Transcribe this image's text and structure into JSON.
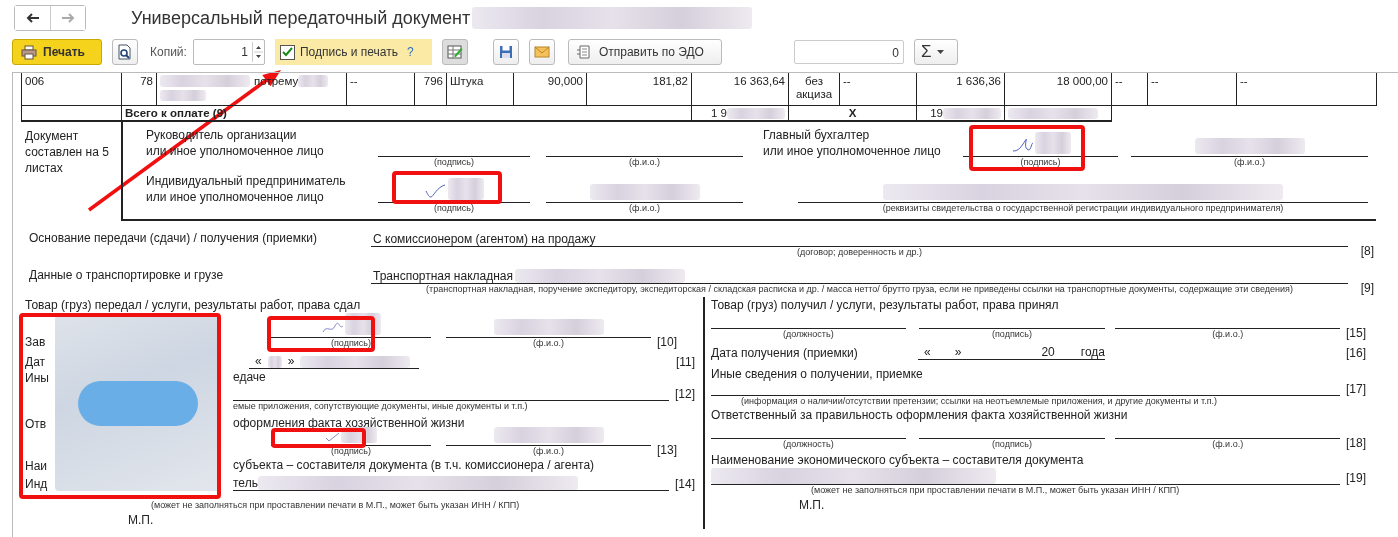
{
  "window": {
    "title": "Универсальный передаточный документ"
  },
  "toolbar": {
    "print": "Печать",
    "copies_label": "Копий:",
    "copies": "1",
    "sign_and_print": {
      "label": "Подпись и печать",
      "checked": true,
      "help": "?"
    },
    "send_edo": "Отправить по ЭДО",
    "total_field": "0",
    "sum_button": "Σ"
  },
  "table": {
    "rows": [
      {
        "cells": [
          "006",
          "78",
          "потрему",
          "--",
          "796",
          "Штука",
          "90,000",
          "181,82",
          "16 363,64",
          "без акциза",
          "--",
          "1 636,36",
          "18 000,00",
          "--",
          "--",
          "--"
        ]
      }
    ],
    "total": {
      "label": "Всего к оплате (9)",
      "amount": "1 9",
      "excise": "X",
      "total_with_tax": "19"
    }
  },
  "signatures": {
    "note": "Документ составлен на 5 листах",
    "head": {
      "label_lines": [
        "Руководитель организации",
        "или иное уполномоченное лицо"
      ],
      "sign_caption": "(подпись)",
      "name_caption": "(ф.и.о.)",
      "signed": false
    },
    "chief_accountant": {
      "label_lines": [
        "Главный бухгалтер",
        "или иное уполномоченное лицо"
      ],
      "sign_caption": "(подпись)",
      "name_caption": "(ф.и.о.)",
      "signed": true
    },
    "entrepreneur": {
      "label_lines": [
        "Индивидуальный предприниматель",
        "или иное уполномоченное лицо"
      ],
      "sign_caption": "(подпись)",
      "name_caption": "(ф.и.о.)",
      "signed": true
    },
    "registration_caption": "(реквизиты свидетельства о государственной  регистрации индивидуального предпринимателя)"
  },
  "transfer_basis": {
    "label": "Основание передачи (сдачи) / получения (приемки)",
    "value": "С комиссионером (агентом) на продажу",
    "caption": "(договор; доверенность и др.)",
    "ref": "[8]"
  },
  "transport": {
    "label": "Данные о транспортировке и грузе",
    "value": "Транспортная накладная",
    "caption": "(транспортная накладная, поручение экспедитору, экспедиторская / складская расписка и др. / масса нетто/ брутто груза, если не приведены ссылки на транспортные документы, содержащие эти сведения)",
    "ref": "[9]"
  },
  "shipper": {
    "heading": "Товар (груз) передал / услуги, результаты работ, права сдал",
    "signature": {
      "label": "Зав",
      "sign_caption": "(подпись)",
      "name_caption": "(ф.и.о.)",
      "signed": true,
      "ref": "[10]"
    },
    "date": {
      "label": "Дат",
      "open_quote": "«",
      "close_quote": "»",
      "ref": "[11]"
    },
    "other": {
      "label_start": "Ины",
      "label_end": "едаче",
      "caption": "емые приложения, сопутствующие документы, иные документы и т.п.)",
      "ref": "[12]"
    },
    "responsible": {
      "label_start": "Отв",
      "label_end": "оформления факта хозяйственной жизни",
      "sign_caption": "(подпись)",
      "name_caption": "(ф.и.о.)",
      "signed": true,
      "ref": "[13]"
    },
    "entity": {
      "label_start": "Наи",
      "label_end": "субъекта – составителя документа (в т.ч. комиссионера / агента)",
      "value_start": "Инд",
      "value_end": "тель",
      "caption": "(может не заполняться при проставлении печати в М.П., может быть указан ИНН / КПП)",
      "ref": "[14]"
    },
    "stamp_mark": "М.П."
  },
  "receiver": {
    "heading": "Товар (груз) получил / услуги, результаты работ, права принял",
    "signature": {
      "captions": [
        "(должность)",
        "(подпись)",
        "(ф.и.о.)"
      ],
      "ref": "[15]"
    },
    "date": {
      "label": "Дата получения (приемки)",
      "open_quote": "«",
      "close_quote": "»",
      "year": "20",
      "year_suffix": "года",
      "ref": "[16]"
    },
    "other": {
      "label": "Иные сведения о получении, приемке",
      "caption": "(информация о наличии/отсутствии претензии; ссылки на неотъемлемые приложения, и другие  документы и т.п.)",
      "ref": "[17]"
    },
    "responsible": {
      "label": "Ответственный за правильность оформления факта хозяйственной жизни",
      "captions": [
        "(должность)",
        "(подпись)",
        "(ф.и.о.)"
      ],
      "ref": "[18]"
    },
    "entity": {
      "label": "Наименование экономического субъекта – составителя документа",
      "caption": "(может не заполняться при проставлении печати в М.П., может быть указан ИНН / КПП)",
      "ref": "[19]"
    },
    "stamp_mark": "М.П."
  }
}
